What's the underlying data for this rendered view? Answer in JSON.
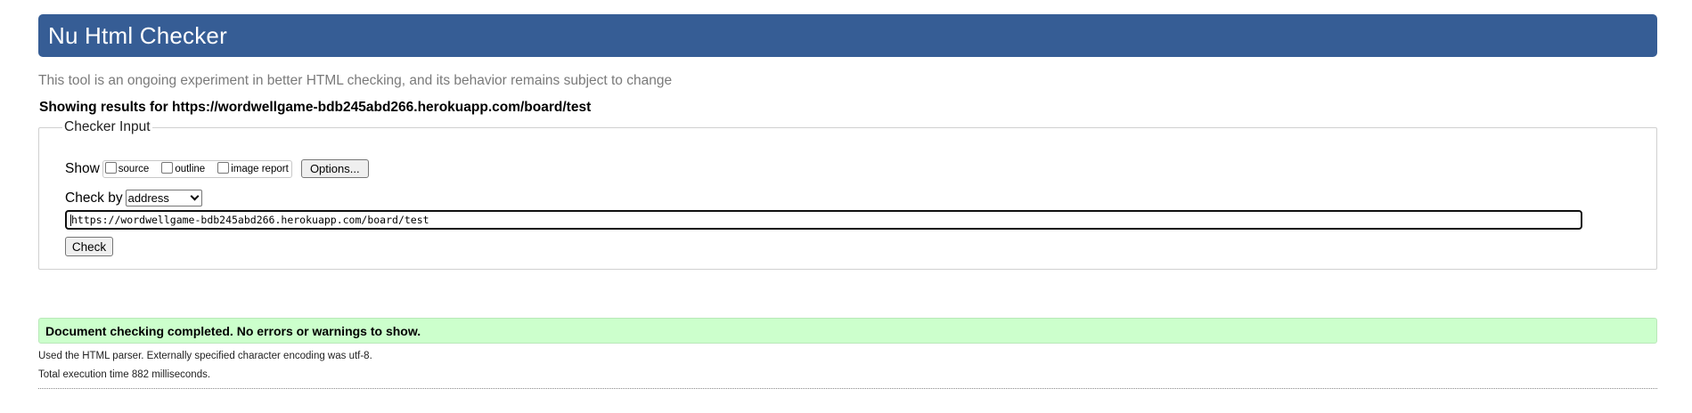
{
  "header": {
    "title": "Nu Html Checker"
  },
  "tagline": "This tool is an ongoing experiment in better HTML checking, and its behavior remains subject to change",
  "results_heading": "Showing results for https://wordwellgame-bdb245abd266.herokuapp.com/board/test",
  "checker_input": {
    "legend": "Checker Input",
    "show_label": "Show",
    "show_options": [
      {
        "label": "source",
        "checked": false
      },
      {
        "label": "outline",
        "checked": false
      },
      {
        "label": "image report",
        "checked": false
      }
    ],
    "options_button_label": "Options...",
    "check_by_label": "Check by",
    "check_by_selected": "address",
    "url_value": "https://wordwellgame-bdb245abd266.herokuapp.com/board/test",
    "check_button_label": "Check"
  },
  "results": {
    "status_message": "Document checking completed. No errors or warnings to show.",
    "parser_info": "Used the HTML parser. Externally specified character encoding was utf-8.",
    "execution_time": "Total execution time 882 milliseconds."
  },
  "colors": {
    "header_bg": "#365d95",
    "success_bg": "#ccffcc",
    "tagline_text": "#7a7a7a"
  }
}
